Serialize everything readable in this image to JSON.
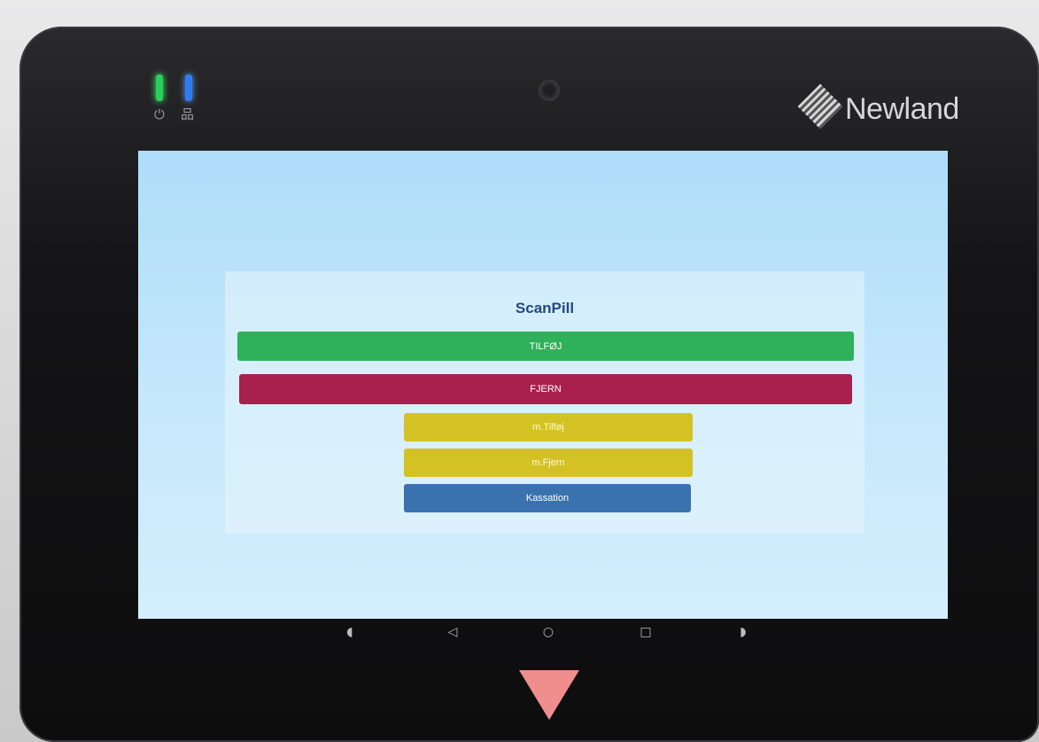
{
  "device": {
    "brand": "Newland",
    "led_icons": {
      "power": "⏻",
      "network": "品"
    }
  },
  "app": {
    "title": "ScanPill",
    "buttons": {
      "add": "TILFØJ",
      "remove": "FJERN",
      "multi_add": "m.Tilføj",
      "multi_remove": "m.Fjern",
      "scrap": "Kassation"
    }
  },
  "navbar": {
    "volume_down": "◖",
    "back": "◁",
    "home": "○",
    "recents": "□",
    "volume_up": "◗"
  },
  "colors": {
    "add": "#2fb05a",
    "remove": "#a8204e",
    "multi": "#d4c224",
    "scrap": "#3a72b0",
    "title": "#234a7d"
  }
}
